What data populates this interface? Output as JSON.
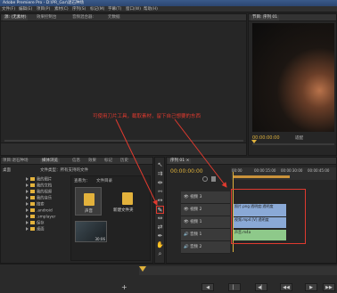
{
  "window": {
    "title": "Adobe Premiere Pro - D:\\PR_Gar\\退石种场"
  },
  "menu": {
    "items": [
      "文件(F)",
      "编辑(E)",
      "项目(P)",
      "素材(C)",
      "序列(S)",
      "标记(M)",
      "字幕(T)",
      "窗口(W)",
      "帮助(H)"
    ]
  },
  "source_panel": {
    "tabs": [
      "源: (无素材)",
      "效果控制台",
      "音频混合器:",
      "元数据"
    ]
  },
  "program_panel": {
    "tab": "节目: 序列 01",
    "timecode": "00:00:00:00",
    "fit_label": "适配"
  },
  "annotation": {
    "text": "可使用刀片工具，截取素材，留下自己想要的东西",
    "color": "#e03a2f"
  },
  "project_panel": {
    "tabs": [
      "项目:退石种场",
      "媒体浏览",
      "信息",
      "效果",
      "标记",
      "历史"
    ],
    "drive_label": "桌面",
    "filetype_label": "文件类型：所有支持的文件",
    "tree": [
      "我的图片",
      "我的文档",
      "我的视频",
      "我的音乐",
      "搜索",
      ".android",
      ".smplayer",
      "保存",
      "桌面"
    ],
    "view_label": "查看为：",
    "view_value": "文件目录",
    "files": [
      {
        "label": "声音"
      },
      {
        "label": "新建文件夹"
      }
    ],
    "thumb_duration": "30:06"
  },
  "tools": [
    "select-tool",
    "track-select-tool",
    "ripple-edit-tool",
    "rolling-edit-tool",
    "rate-stretch-tool",
    "razor-tool",
    "slip-tool",
    "slide-tool",
    "pen-tool",
    "hand-tool",
    "zoom-tool"
  ],
  "timeline": {
    "tab": "序列 01 ×",
    "timecode": "00:00:00:00",
    "ruler": [
      "00:00",
      "00:00:15:00",
      "00:00:30:00",
      "00:00:45:00"
    ],
    "tracks": [
      {
        "label": "视频 3"
      },
      {
        "label": "视频 2"
      },
      {
        "label": "视频 1"
      },
      {
        "label": "音频 1"
      },
      {
        "label": "音频 2"
      }
    ],
    "clips": [
      {
        "label": "照片.png 透明度:透明度"
      },
      {
        "label": "视频.mp4 [V] 透明度"
      },
      {
        "label": "声音.m4a"
      }
    ]
  },
  "transport": {
    "buttons": [
      "◀",
      "▏",
      "◀▏",
      "◀◀",
      "▶",
      "▶▶"
    ]
  }
}
